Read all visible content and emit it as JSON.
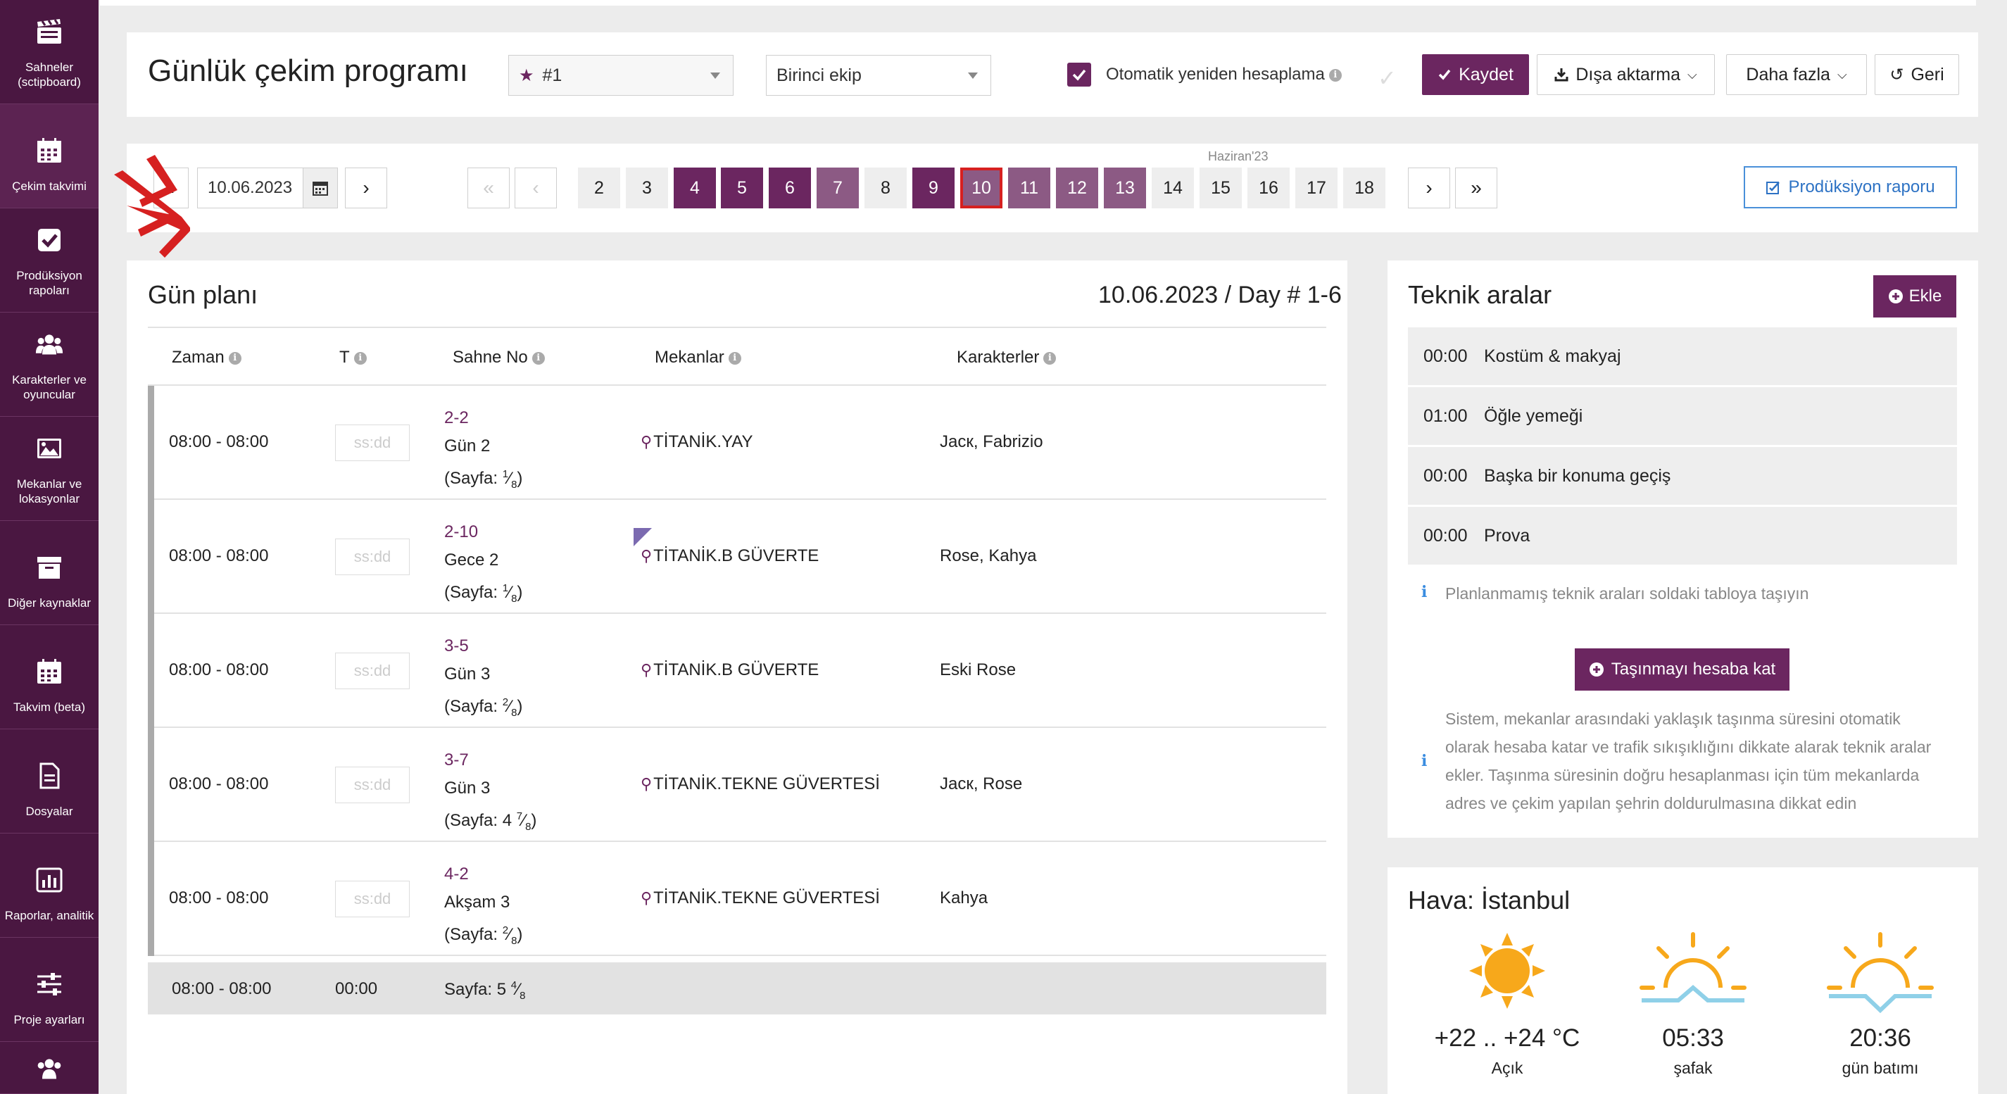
{
  "sidebar": {
    "items": [
      {
        "label": "Sahneler (sctipboard)",
        "icon": "clapperboard-icon"
      },
      {
        "label": "Çekim takvimi",
        "icon": "calendar-icon"
      },
      {
        "label": "Prodüksiyon rapoları",
        "icon": "checkbox-icon"
      },
      {
        "label": "Karakterler ve oyuncular",
        "icon": "users-icon"
      },
      {
        "label": "Mekanlar ve lokasyonlar",
        "icon": "image-icon"
      },
      {
        "label": "Diğer kaynaklar",
        "icon": "archive-icon"
      },
      {
        "label": "Takvim (beta)",
        "icon": "calendar-icon"
      },
      {
        "label": "Dosyalar",
        "icon": "document-icon"
      },
      {
        "label": "Raporlar, analitik",
        "icon": "chart-icon"
      },
      {
        "label": "Proje ayarları",
        "icon": "sliders-icon"
      }
    ]
  },
  "header": {
    "title": "Günlük çekim programı",
    "schedule_select": "#1",
    "crew_select": "Birinci ekip",
    "auto_recalc_label": "Otomatik yeniden hesaplama",
    "save_label": "Kaydet",
    "export_label": "Dışa aktarma",
    "more_label": "Daha fazla",
    "back_label": "Geri"
  },
  "date_nav": {
    "date_value": "10.06.2023",
    "month_label": "Haziran'23",
    "days": [
      "2",
      "3",
      "4",
      "5",
      "6",
      "7",
      "8",
      "9",
      "10",
      "11",
      "12",
      "13",
      "14",
      "15",
      "16",
      "17",
      "18"
    ],
    "production_report_label": "Prodüksiyon raporu"
  },
  "plan": {
    "title": "Gün planı",
    "date_label": "10.06.2023 / Day # 1-6",
    "columns": {
      "time": "Zaman",
      "t": "T",
      "scene": "Sahne No",
      "location": "Mekanlar",
      "characters": "Karakterler"
    },
    "placeholder": "ss:dd",
    "rows": [
      {
        "time": "08:00 - 08:00",
        "scene_no": "2-2",
        "day": "Gün 2",
        "page_prefix": "(Sayfa: ",
        "page_whole": "",
        "page_num": "1",
        "page_den": "8",
        "page_suffix": ")",
        "location": "TİTANİK.YAY",
        "characters": "Jacк, Fabrizio"
      },
      {
        "time": "08:00 - 08:00",
        "scene_no": "2-10",
        "day": "Gece 2",
        "page_prefix": "(Sayfa: ",
        "page_whole": "",
        "page_num": "1",
        "page_den": "8",
        "page_suffix": ")",
        "location": "TİTANİK.B GÜVERTE",
        "characters": "Rose, Kahya"
      },
      {
        "time": "08:00 - 08:00",
        "scene_no": "3-5",
        "day": "Gün 3",
        "page_prefix": "(Sayfa: ",
        "page_whole": "",
        "page_num": "2",
        "page_den": "8",
        "page_suffix": ")",
        "location": "TİTANİK.B GÜVERTE",
        "characters": "Eski Rose"
      },
      {
        "time": "08:00 - 08:00",
        "scene_no": "3-7",
        "day": "Gün 3",
        "page_prefix": "(Sayfa: ",
        "page_whole": "4 ",
        "page_num": "7",
        "page_den": "8",
        "page_suffix": ")",
        "location": "TİTANİK.TEKNE GÜVERTESİ",
        "characters": "Jacк, Rose"
      },
      {
        "time": "08:00 - 08:00",
        "scene_no": "4-2",
        "day": "Akşam 3",
        "page_prefix": "(Sayfa: ",
        "page_whole": "",
        "page_num": "2",
        "page_den": "8",
        "page_suffix": ")",
        "location": "TİTANİK.TEKNE GÜVERTESİ",
        "characters": "Kahya"
      }
    ],
    "total": {
      "time": "08:00 - 08:00",
      "t": "00:00",
      "page_prefix": "Sayfa: 5 ",
      "page_num": "4",
      "page_den": "8"
    }
  },
  "technical": {
    "title": "Teknik aralar",
    "add_label": "Ekle",
    "items": [
      {
        "time": "00:00",
        "name": "Kostüm & makyaj"
      },
      {
        "time": "01:00",
        "name": "Öğle yemeği"
      },
      {
        "time": "00:00",
        "name": "Başka bir konuma geçiş"
      },
      {
        "time": "00:00",
        "name": "Prova"
      }
    ],
    "hint": "Planlanmamış teknik araları soldaki tabloya taşıyın",
    "move_button": "Taşınmayı hesaba kat",
    "note_lines": [
      "Sistem, mekanlar arasındaki yaklaşık taşınma süresini otomatik",
      "olarak hesaba katar ve trafik sıkışıklığını dikkate alarak teknik aralar",
      "ekler. Taşınma süresinin doğru hesaplanması için tüm mekanlarda",
      "adres ve çekim yapılan şehrin doldurulmasına dikkat edin"
    ]
  },
  "weather": {
    "title": "Hava: İstanbul",
    "temp": "+22 .. +24 °C",
    "condition": "Açık",
    "sunrise_time": "05:33",
    "sunrise_label": "şafak",
    "sunset_time": "20:36",
    "sunset_label": "gün batımı"
  },
  "colors": {
    "brand": "#6b2660",
    "sidebar": "#4a1741",
    "link": "#2d72c4",
    "selected_border": "#d62020",
    "sun": "#f7a81b",
    "horizon": "#8fd0e8"
  }
}
